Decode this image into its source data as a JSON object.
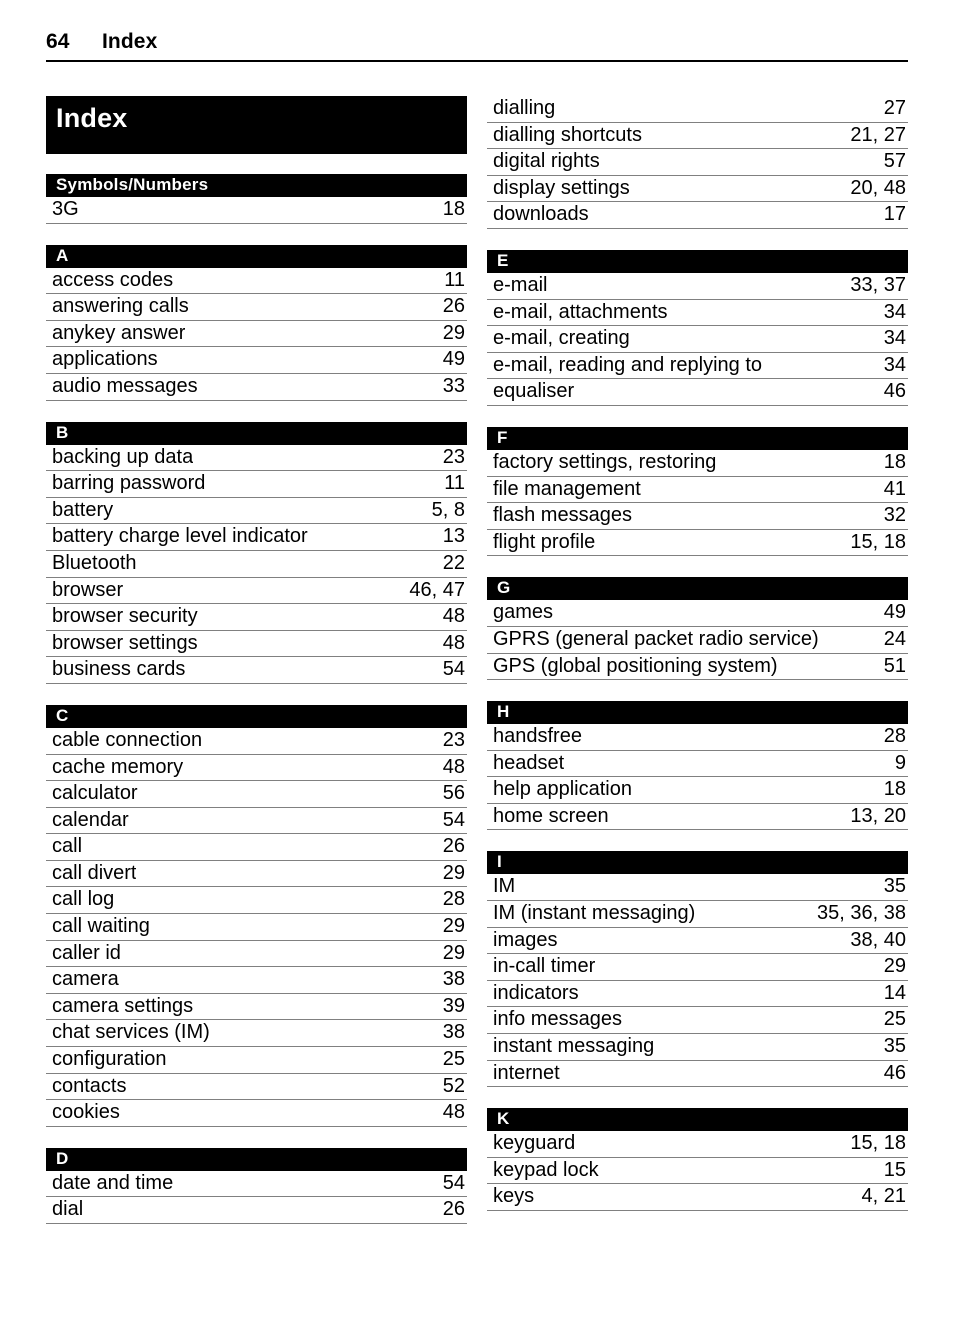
{
  "header": {
    "folio": "64",
    "running_title": "Index"
  },
  "title_bar": {
    "text": "Index"
  },
  "columns": [
    {
      "id": "left",
      "sections": [
        {
          "letter": "Symbols/Numbers",
          "wide": true,
          "entries": [
            {
              "term": "3G",
              "pages": "18"
            }
          ]
        },
        {
          "letter": "A",
          "entries": [
            {
              "term": "access codes",
              "pages": "11"
            },
            {
              "term": "answering calls",
              "pages": "26"
            },
            {
              "term": "anykey answer",
              "pages": "29"
            },
            {
              "term": "applications",
              "pages": "49"
            },
            {
              "term": "audio messages",
              "pages": "33"
            }
          ]
        },
        {
          "letter": "B",
          "entries": [
            {
              "term": "backing up data",
              "pages": "23"
            },
            {
              "term": "barring password",
              "pages": "11"
            },
            {
              "term": "battery",
              "pages": "5, 8"
            },
            {
              "term": "battery charge level indicator",
              "pages": "13"
            },
            {
              "term": "Bluetooth",
              "pages": "22"
            },
            {
              "term": "browser",
              "pages": "46, 47"
            },
            {
              "term": "browser security",
              "pages": "48"
            },
            {
              "term": "browser settings",
              "pages": "48"
            },
            {
              "term": "business cards",
              "pages": "54"
            }
          ]
        },
        {
          "letter": "C",
          "entries": [
            {
              "term": "cable connection",
              "pages": "23"
            },
            {
              "term": "cache memory",
              "pages": "48"
            },
            {
              "term": "calculator",
              "pages": "56"
            },
            {
              "term": "calendar",
              "pages": "54"
            },
            {
              "term": "call",
              "pages": "26"
            },
            {
              "term": "call divert",
              "pages": "29"
            },
            {
              "term": "call log",
              "pages": "28"
            },
            {
              "term": "call waiting",
              "pages": "29"
            },
            {
              "term": "caller id",
              "pages": "29"
            },
            {
              "term": "camera",
              "pages": "38"
            },
            {
              "term": "camera settings",
              "pages": "39"
            },
            {
              "term": "chat services (IM)",
              "pages": "38"
            },
            {
              "term": "configuration",
              "pages": "25"
            },
            {
              "term": "contacts",
              "pages": "52"
            },
            {
              "term": "cookies",
              "pages": "48"
            }
          ]
        },
        {
          "letter": "D",
          "entries": [
            {
              "term": "date and time",
              "pages": "54"
            },
            {
              "term": "dial",
              "pages": "26"
            }
          ]
        }
      ]
    },
    {
      "id": "right",
      "sections": [
        {
          "letter": "",
          "continuation": true,
          "entries": [
            {
              "term": "dialling",
              "pages": "27"
            },
            {
              "term": "dialling shortcuts",
              "pages": "21, 27"
            },
            {
              "term": "digital rights",
              "pages": "57"
            },
            {
              "term": "display settings",
              "pages": "20, 48"
            },
            {
              "term": "downloads",
              "pages": "17"
            }
          ]
        },
        {
          "letter": "E",
          "entries": [
            {
              "term": "e-mail",
              "pages": "33, 37"
            },
            {
              "term": "e-mail, attachments",
              "pages": "34"
            },
            {
              "term": "e-mail, creating",
              "pages": "34"
            },
            {
              "term": "e-mail, reading and replying to",
              "pages": "34"
            },
            {
              "term": "equaliser",
              "pages": "46"
            }
          ]
        },
        {
          "letter": "F",
          "entries": [
            {
              "term": "factory settings, restoring",
              "pages": "18"
            },
            {
              "term": "file management",
              "pages": "41"
            },
            {
              "term": "flash messages",
              "pages": "32"
            },
            {
              "term": "flight profile",
              "pages": "15, 18"
            }
          ]
        },
        {
          "letter": "G",
          "entries": [
            {
              "term": "games",
              "pages": "49"
            },
            {
              "term": "GPRS (general packet radio service)",
              "pages": "24"
            },
            {
              "term": "GPS (global positioning system)",
              "pages": "51"
            }
          ]
        },
        {
          "letter": "H",
          "entries": [
            {
              "term": "handsfree",
              "pages": "28"
            },
            {
              "term": "headset",
              "pages": "9"
            },
            {
              "term": "help application",
              "pages": "18"
            },
            {
              "term": "home screen",
              "pages": "13, 20"
            }
          ]
        },
        {
          "letter": "I",
          "entries": [
            {
              "term": "IM",
              "pages": "35"
            },
            {
              "term": "IM (instant messaging)",
              "pages": "35, 36, 38"
            },
            {
              "term": "images",
              "pages": "38, 40"
            },
            {
              "term": "in-call timer",
              "pages": "29"
            },
            {
              "term": "indicators",
              "pages": "14"
            },
            {
              "term": "info messages",
              "pages": "25"
            },
            {
              "term": "instant messaging",
              "pages": "35"
            },
            {
              "term": "internet",
              "pages": "46"
            }
          ]
        },
        {
          "letter": "K",
          "entries": [
            {
              "term": "keyguard",
              "pages": "15, 18"
            },
            {
              "term": "keypad lock",
              "pages": "15"
            },
            {
              "term": "keys",
              "pages": "4, 21"
            }
          ]
        }
      ]
    }
  ]
}
